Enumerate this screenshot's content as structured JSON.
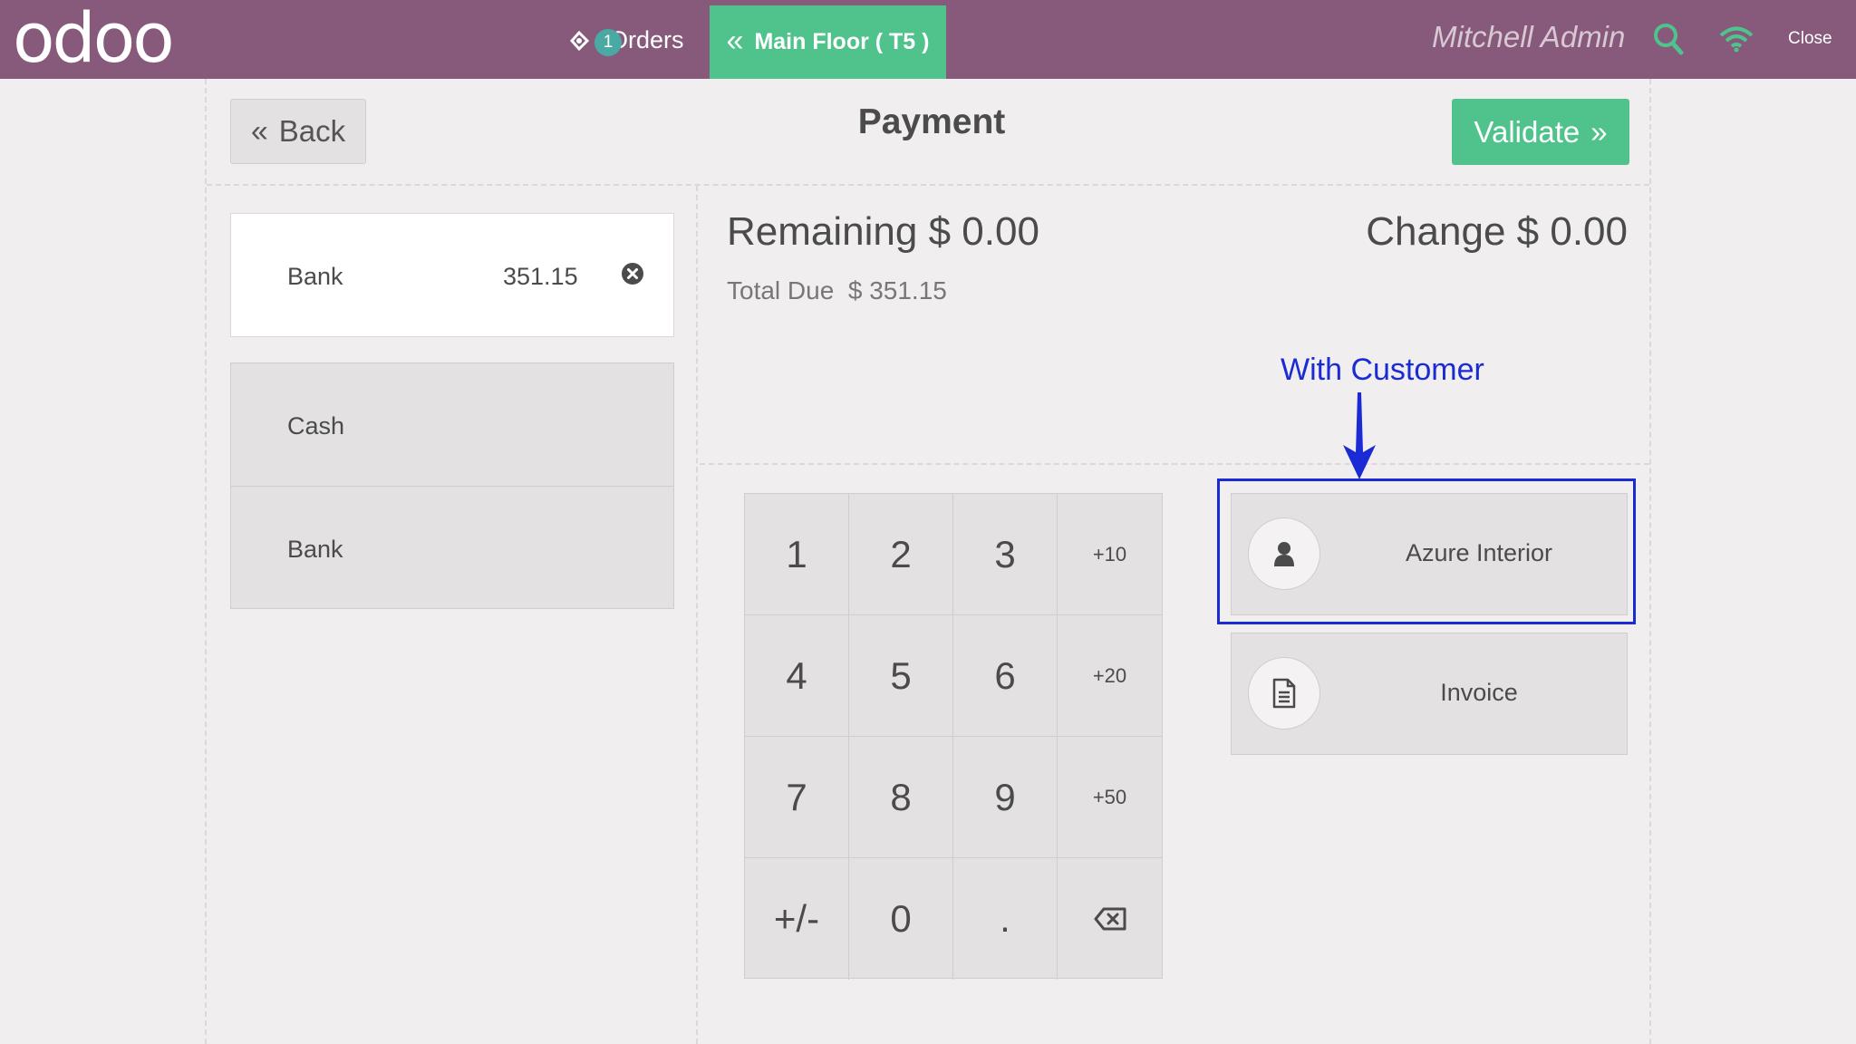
{
  "navbar": {
    "logo_text": "odoo",
    "orders_label": "Orders",
    "orders_count": "1",
    "floor_label": "Main Floor ( T5 )",
    "user_name": "Mitchell Admin",
    "close_label": "Close",
    "icons": [
      "ticket-icon",
      "search-icon",
      "wifi-icon"
    ],
    "colors": {
      "bar": "#875a7b",
      "accent": "#4fc38b",
      "status_icon": "#4fc38b"
    }
  },
  "header": {
    "back_label": "Back",
    "title": "Payment",
    "validate_label": "Validate"
  },
  "paymentlines": [
    {
      "name": "Bank",
      "amount": "351.15"
    }
  ],
  "payment_methods": [
    {
      "name": "Cash"
    },
    {
      "name": "Bank"
    }
  ],
  "summary": {
    "remaining_label": "Remaining",
    "remaining_value": "$ 0.00",
    "change_label": "Change",
    "change_value": "$ 0.00",
    "total_due_label": "Total Due",
    "total_due_value": "$ 351.15"
  },
  "numpad": {
    "keys": [
      "1",
      "2",
      "3",
      "+10",
      "4",
      "5",
      "6",
      "+20",
      "7",
      "8",
      "9",
      "+50",
      "+/-",
      "0",
      ".",
      "⌫"
    ]
  },
  "actions": {
    "customer_label": "Azure Interior",
    "invoice_label": "Invoice"
  },
  "annotation": {
    "label": "With Customer",
    "color": "#1a2bd6"
  }
}
